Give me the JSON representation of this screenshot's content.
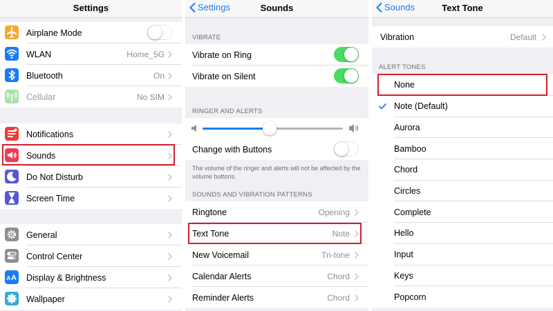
{
  "colors": {
    "accent": "#1a7cf5",
    "switch_on": "#4cd964",
    "highlight": "#d11f2a"
  },
  "settings": {
    "title": "Settings",
    "group1": [
      {
        "label": "Airplane Mode",
        "icon": "airplane-icon",
        "color": "#f7a733",
        "control": "switch",
        "on": false
      },
      {
        "label": "WLAN",
        "icon": "wifi-icon",
        "color": "#1a7cf5",
        "value": "Home_5G"
      },
      {
        "label": "Bluetooth",
        "icon": "bluetooth-icon",
        "color": "#1a7cf5",
        "value": "On"
      },
      {
        "label": "Cellular",
        "icon": "cellular-icon",
        "color": "#a9e0a9",
        "value": "No SIM",
        "dimmed": true
      }
    ],
    "group2": [
      {
        "label": "Notifications",
        "icon": "notifications-icon",
        "color": "#ee3b35"
      },
      {
        "label": "Sounds",
        "icon": "speaker-icon",
        "color": "#ee3b57"
      },
      {
        "label": "Do Not Disturb",
        "icon": "moon-icon",
        "color": "#5856d6"
      },
      {
        "label": "Screen Time",
        "icon": "hourglass-icon",
        "color": "#5856d6"
      }
    ],
    "group3": [
      {
        "label": "General",
        "icon": "gear-icon",
        "color": "#8e8e93"
      },
      {
        "label": "Control Center",
        "icon": "toggles-icon",
        "color": "#8e8e93"
      },
      {
        "label": "Display & Brightness",
        "icon": "text-size-icon",
        "color": "#1a7cf5"
      },
      {
        "label": "Wallpaper",
        "icon": "flower-icon",
        "color": "#34aadc"
      }
    ]
  },
  "sounds": {
    "back_label": "Settings",
    "title": "Sounds",
    "vibrate_header": "VIBRATE",
    "vibrate": [
      {
        "label": "Vibrate on Ring",
        "on": true
      },
      {
        "label": "Vibrate on Silent",
        "on": true
      }
    ],
    "ringer_header": "RINGER AND ALERTS",
    "volume_level": 0.48,
    "change_with_buttons": {
      "label": "Change with Buttons",
      "on": false
    },
    "ringer_footer": "The volume of the ringer and alerts will not be affected by the volume buttons.",
    "patterns_header": "SOUNDS AND VIBRATION PATTERNS",
    "patterns": [
      {
        "label": "Ringtone",
        "value": "Opening"
      },
      {
        "label": "Text Tone",
        "value": "Note"
      },
      {
        "label": "New Voicemail",
        "value": "Tri-tone"
      },
      {
        "label": "Calendar Alerts",
        "value": "Chord"
      },
      {
        "label": "Reminder Alerts",
        "value": "Chord"
      }
    ]
  },
  "text_tone": {
    "back_label": "Sounds",
    "title": "Text Tone",
    "vibration": {
      "label": "Vibration",
      "value": "Default"
    },
    "alert_header": "ALERT TONES",
    "tones": [
      "None",
      "Note (Default)",
      "Aurora",
      "Bamboo",
      "Chord",
      "Circles",
      "Complete",
      "Hello",
      "Input",
      "Keys",
      "Popcorn"
    ],
    "selected_index": 1
  }
}
